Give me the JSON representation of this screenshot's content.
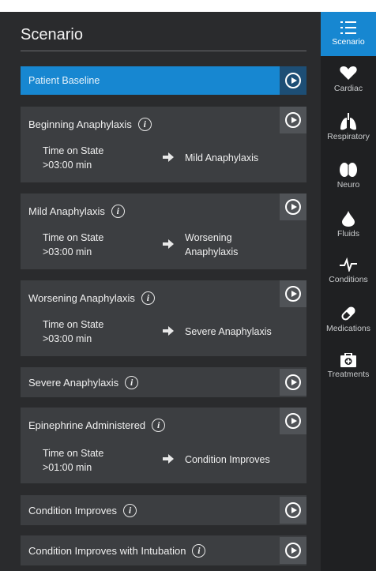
{
  "title": "Scenario",
  "baseline": {
    "label": "Patient Baseline"
  },
  "cards": [
    {
      "title": "Beginning Anaphylaxis",
      "time_label": "Time on State",
      "time_value": ">03:00 min",
      "target": "Mild Anaphylaxis"
    },
    {
      "title": "Mild Anaphylaxis",
      "time_label": "Time on State",
      "time_value": ">03:00 min",
      "target_line1": "Worsening",
      "target_line2": "Anaphylaxis"
    },
    {
      "title": "Worsening Anaphylaxis",
      "time_label": "Time on State",
      "time_value": ">03:00 min",
      "target": "Severe Anaphylaxis"
    },
    {
      "title": "Severe Anaphylaxis"
    },
    {
      "title": "Epinephrine Administered",
      "time_label": "Time on State",
      "time_value": ">01:00 min",
      "target": "Condition Improves"
    },
    {
      "title": "Condition Improves"
    },
    {
      "title": "Condition Improves with Intubation"
    }
  ],
  "info_glyph": "i",
  "sidebar": {
    "items": [
      {
        "label": "Scenario",
        "icon": "list-icon",
        "active": true
      },
      {
        "label": "Cardiac",
        "icon": "heart-icon"
      },
      {
        "label": "Respiratory",
        "icon": "lungs-icon"
      },
      {
        "label": "Neuro",
        "icon": "brain-icon"
      },
      {
        "label": "Fluids",
        "icon": "drop-icon"
      },
      {
        "label": "Conditions",
        "icon": "pulse-icon"
      },
      {
        "label": "Medications",
        "icon": "pill-icon"
      },
      {
        "label": "Treatments",
        "icon": "medkit-icon"
      }
    ]
  },
  "colors": {
    "accent": "#1787d1",
    "card": "#3c3e41",
    "background": "#2a2b2d",
    "sidebar": "#1f2022"
  }
}
